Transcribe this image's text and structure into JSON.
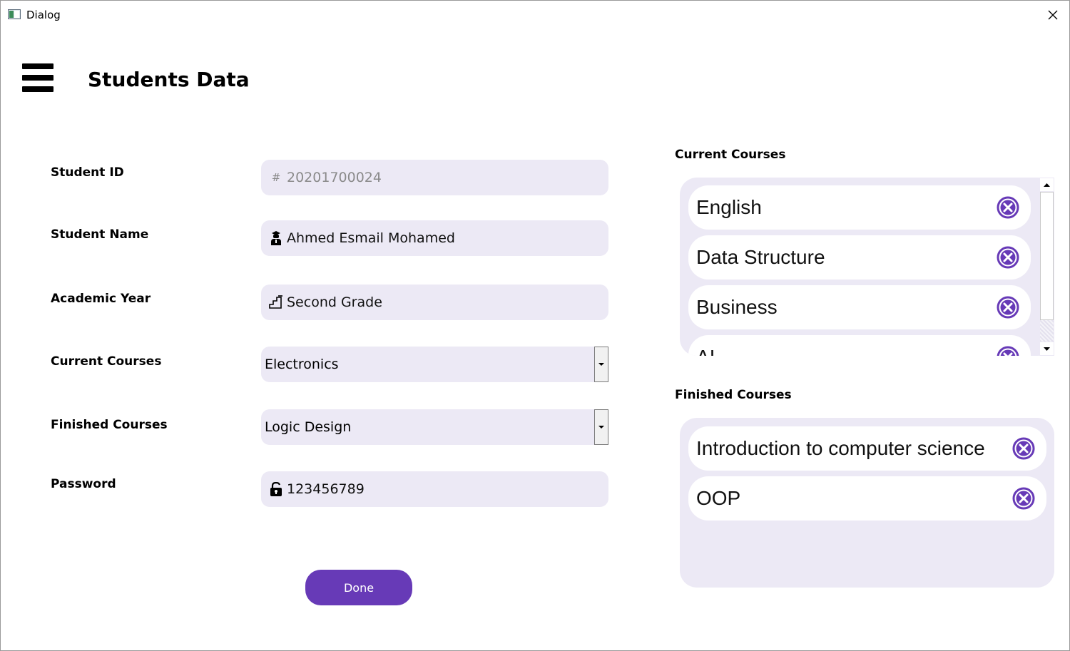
{
  "window": {
    "title": "Dialog"
  },
  "header": {
    "title": "Students Data"
  },
  "form": {
    "student_id": {
      "label": "Student ID",
      "value": "20201700024"
    },
    "student_name": {
      "label": "Student Name",
      "value": "Ahmed Esmail Mohamed"
    },
    "academic_year": {
      "label": "Academic Year",
      "value": "Second Grade"
    },
    "current_courses": {
      "label": "Current Courses",
      "selected": "Electronics"
    },
    "finished_courses": {
      "label": "Finished Courses",
      "selected": "Logic Design"
    },
    "password": {
      "label": "Password",
      "value": "123456789"
    },
    "done_label": "Done"
  },
  "current_panel": {
    "label": "Current Courses",
    "items": [
      "English",
      "Data Structure",
      "Business",
      "AI"
    ]
  },
  "finished_panel": {
    "label": "Finished Courses",
    "items": [
      "Introduction to computer science",
      "OOP"
    ]
  },
  "icons": {
    "hash": "hash-icon",
    "student": "student-icon",
    "stairs": "stairs-icon",
    "lock": "unlock-icon",
    "remove": "remove-circle-icon"
  },
  "colors": {
    "accent": "#673ab7",
    "field_bg": "#ece9f5",
    "remove_icon": "#673ab7"
  }
}
